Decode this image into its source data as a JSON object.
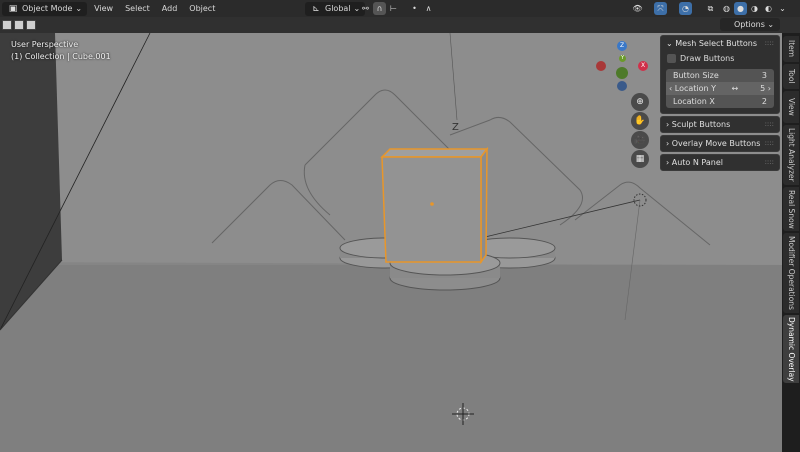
{
  "header": {
    "mode": "Object Mode",
    "menus": [
      "View",
      "Select",
      "Add",
      "Object"
    ],
    "orientation": "Global",
    "options_label": "Options"
  },
  "viewport": {
    "perspective": "User Perspective",
    "collection": "(1) Collection",
    "object": "Cube.001",
    "selection_color": "#e8962a"
  },
  "npanel": {
    "mesh_select": {
      "title": "Mesh Select Buttons",
      "draw_buttons": "Draw Buttons",
      "draw_buttons_checked": false,
      "fields": [
        {
          "label": "Button Size",
          "value": "3"
        },
        {
          "label": "Location Y",
          "value": "5"
        },
        {
          "label": "Location X",
          "value": "2"
        }
      ]
    },
    "collapsed": [
      "Sculpt Buttons",
      "Overlay Move Buttons",
      "Auto N Panel"
    ]
  },
  "tabs": [
    "Item",
    "Tool",
    "View",
    "Light Analyzer",
    "Real Snow",
    "Modifier Operations",
    "Dynamic Overlay"
  ],
  "active_tab": "Dynamic Overlay",
  "gizmo": {
    "z": "Z",
    "x": "X",
    "y": "Y"
  },
  "nav_icons": [
    "zoom-icon",
    "hand-pan-icon",
    "camera-icon",
    "grid-ortho-icon"
  ]
}
